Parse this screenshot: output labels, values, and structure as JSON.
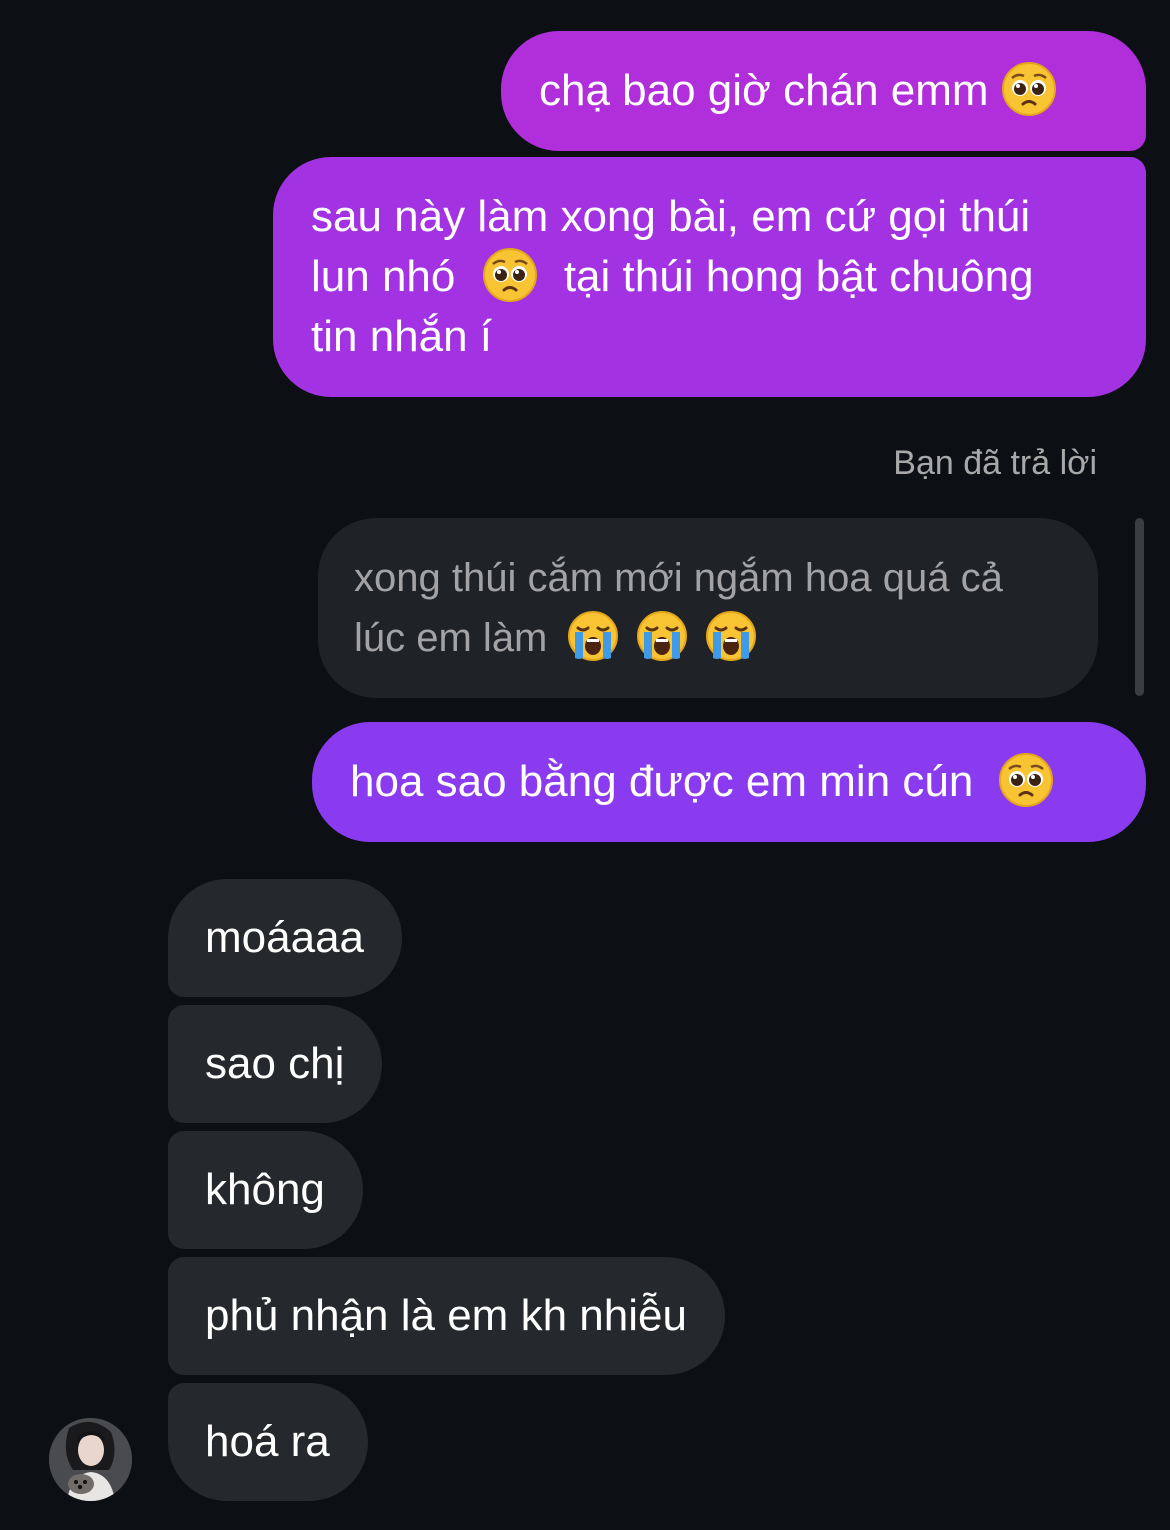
{
  "messages_sent": {
    "m1": {
      "text": "chạ bao giờ chán emm",
      "emoji": "pleading-face"
    },
    "m2": {
      "line1": "sau này làm xong bài, em cứ gọi thúi",
      "line2_a": "lun nhó",
      "line2_emoji": "pleading-face",
      "line2_b": "tại thúi hong bật chuông",
      "line3": "tin nhắn í"
    },
    "m3": {
      "text": "hoa sao bằng được em min cún",
      "emoji": "pleading-face"
    }
  },
  "reply_context": {
    "label": "Bạn đã trả lời",
    "quoted_line1": "xong thúi cắm mới ngắm hoa quá cả",
    "quoted_line2": "lúc em làm",
    "quoted_emojis": [
      "loudly-crying-face",
      "loudly-crying-face",
      "loudly-crying-face"
    ]
  },
  "messages_received": [
    {
      "text": "moáaaa"
    },
    {
      "text": "sao chị"
    },
    {
      "text": "không"
    },
    {
      "text": "phủ nhận là em kh nhiễu"
    },
    {
      "text": "hoá ra"
    }
  ],
  "colors": {
    "background": "#0c1014",
    "sent_top": "#b02fda",
    "sent_mid": "#a232e2",
    "sent_bottom": "#8a3bf0",
    "received": "#25282c",
    "quoted_bubble": "#1f2226",
    "muted_text": "#a8a8a8"
  }
}
